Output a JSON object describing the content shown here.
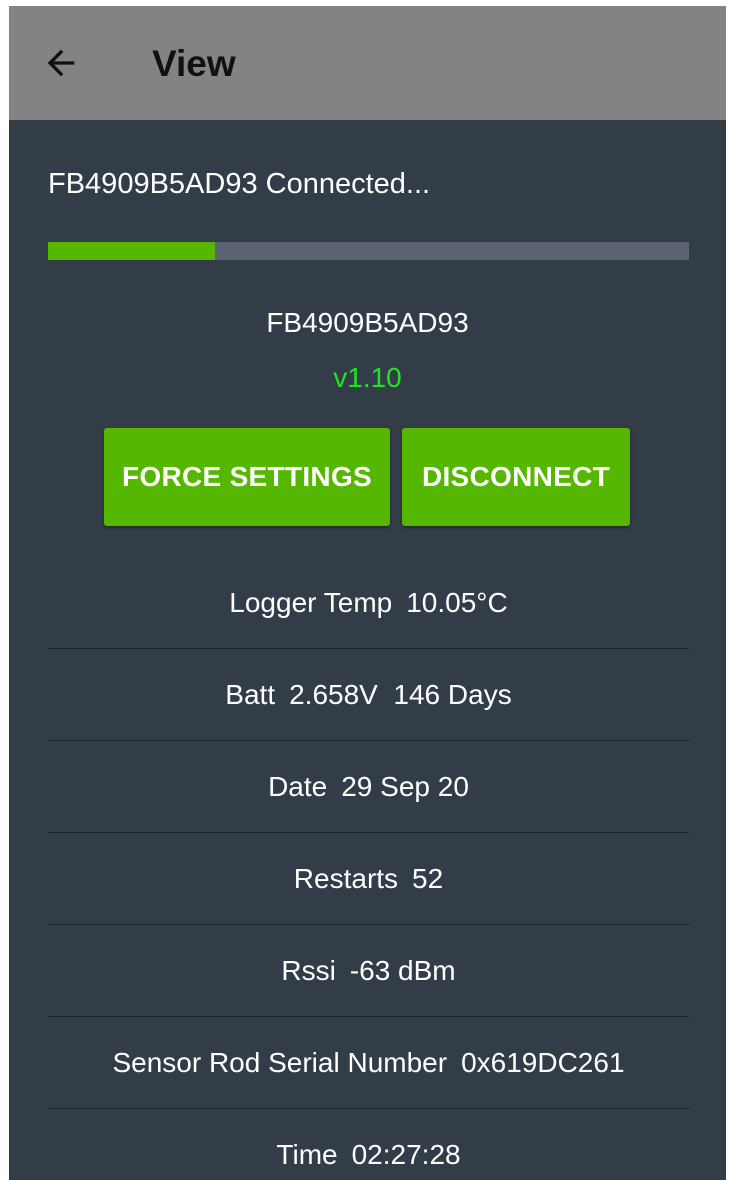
{
  "appbar": {
    "title": "View",
    "back_icon": "arrow-left-icon"
  },
  "status_text": "FB4909B5AD93 Connected...",
  "progress": {
    "fraction": 0.26,
    "fill_color": "#55b700",
    "track_color": "#5b6470"
  },
  "device": {
    "name": "FB4909B5AD93",
    "version": "v1.10",
    "version_color": "#22e322"
  },
  "buttons": {
    "force_settings": "FORCE SETTINGS",
    "disconnect": "DISCONNECT",
    "color": "#56b700"
  },
  "info": {
    "logger_temp": {
      "label": "Logger Temp",
      "value": "10.05°C"
    },
    "batt": {
      "label": "Batt",
      "value": "2.658V  146 Days"
    },
    "date": {
      "label": "Date",
      "value": "29 Sep 20"
    },
    "restarts": {
      "label": "Restarts",
      "value": "52"
    },
    "rssi": {
      "label": "Rssi",
      "value": "-63 dBm"
    },
    "sensor_serial": {
      "label": "Sensor Rod Serial Number",
      "value": "0x619DC261"
    },
    "time": {
      "label": "Time",
      "value": "02:27:28"
    }
  },
  "colors": {
    "background": "#333d48",
    "appbar": "#838383"
  }
}
